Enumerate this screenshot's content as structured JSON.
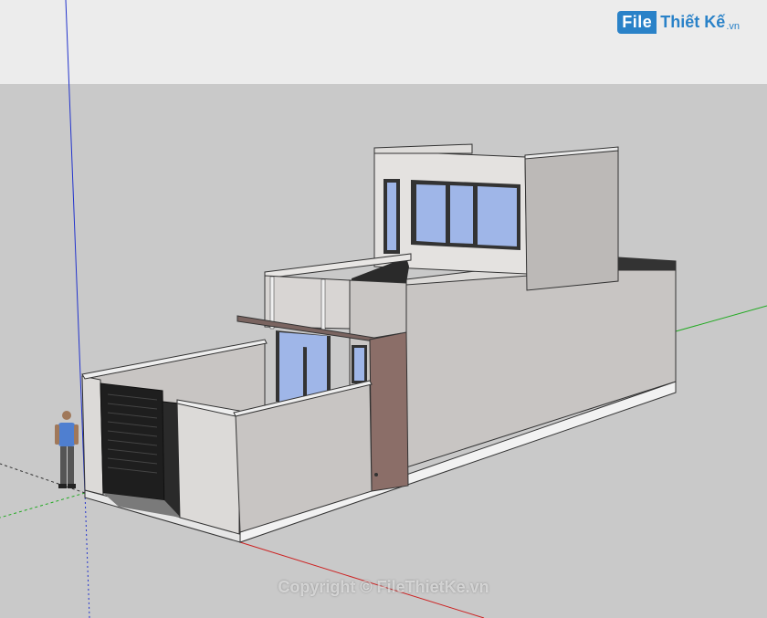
{
  "watermark": {
    "logo_mark": "File",
    "logo_name": "Thiết Kế",
    "logo_domain": ".vn",
    "copyright": "Copyright © FileThietKe.vn"
  },
  "colors": {
    "sky": "#ececec",
    "ground": "#c9c9c9",
    "wall_light": "#e4e2e0",
    "wall_mid": "#c8c5c3",
    "wall_shade": "#bcb9b7",
    "glass": "#9fb6e8",
    "door_panel": "#8b6e68",
    "gate": "#1e1e1e",
    "axis_red": "#cc2222",
    "axis_green": "#22aa22",
    "axis_blue": "#2233cc",
    "logo_blue": "#2a82c8"
  },
  "icons": {
    "model": "house-3d-model",
    "figure": "scale-figure-person"
  }
}
